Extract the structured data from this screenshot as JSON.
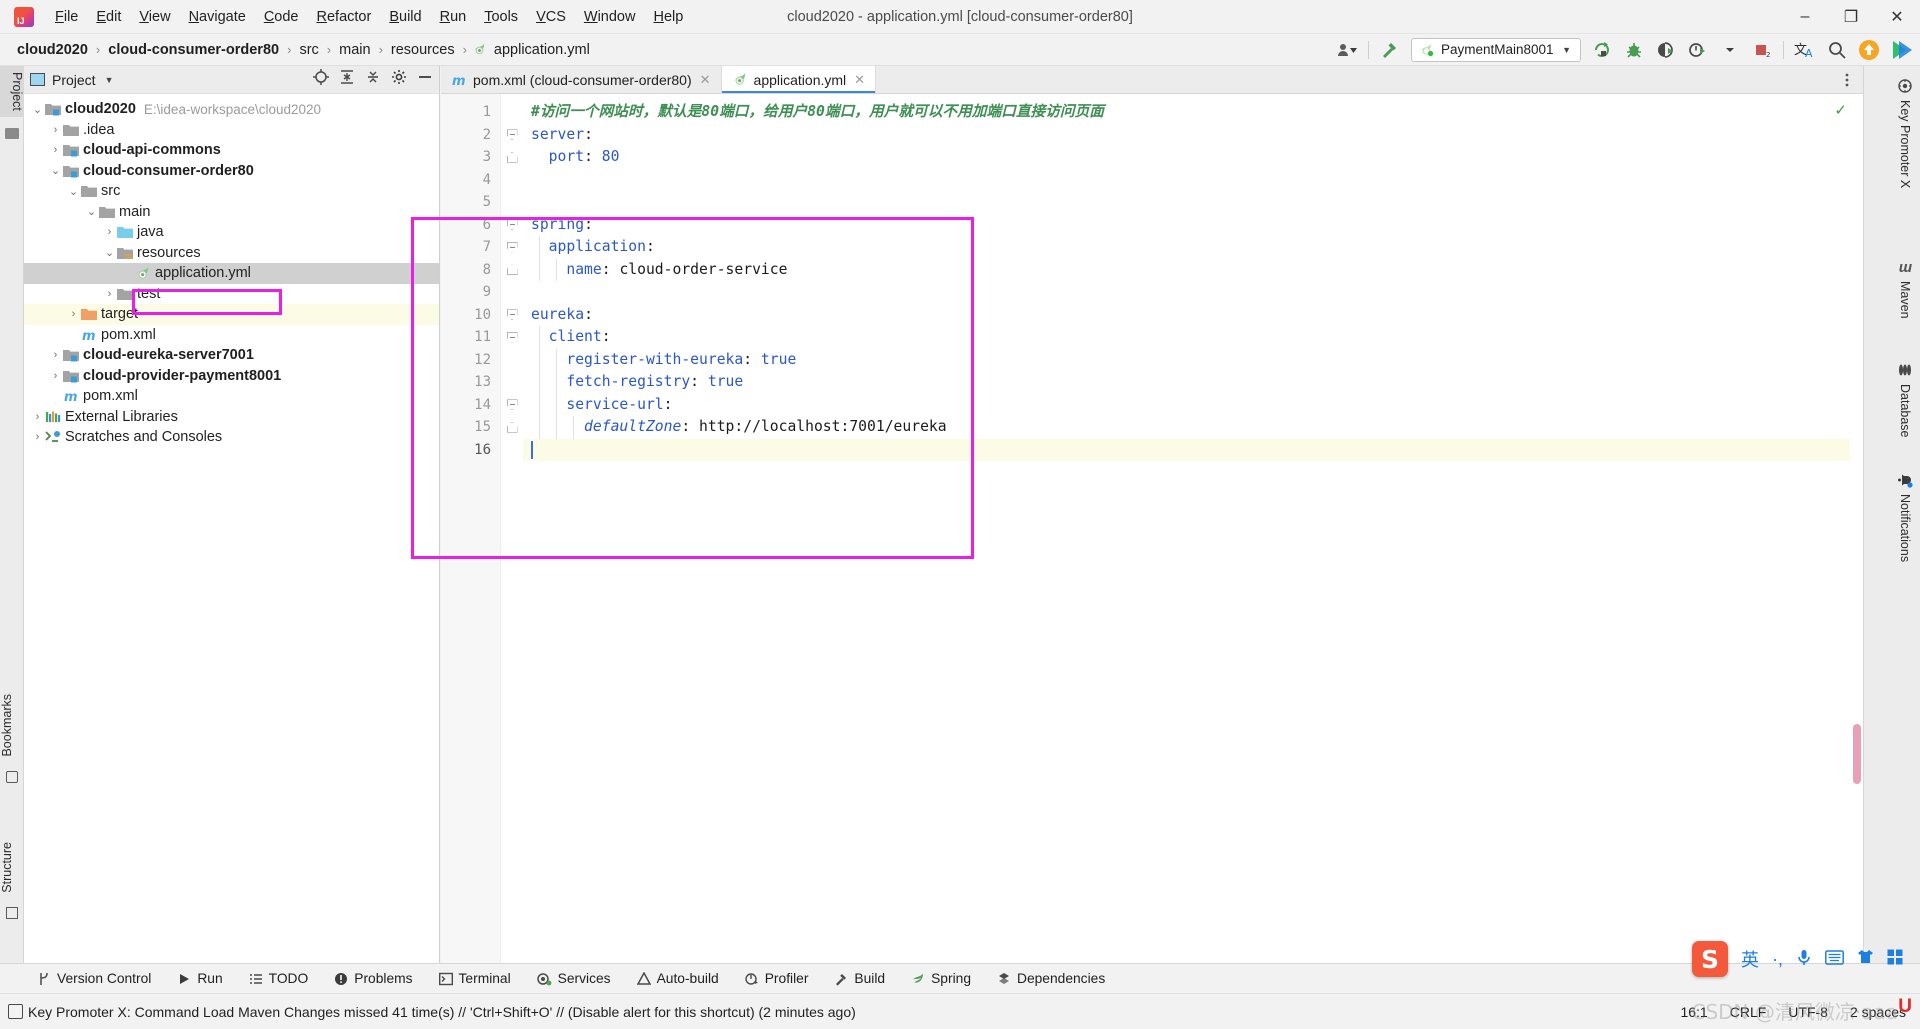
{
  "window": {
    "title": "cloud2020 - application.yml [cloud-consumer-order80]",
    "minimize": "–",
    "maximize": "❐",
    "close": "✕"
  },
  "menubar": {
    "items": [
      {
        "label": "File"
      },
      {
        "label": "Edit"
      },
      {
        "label": "View"
      },
      {
        "label": "Navigate"
      },
      {
        "label": "Code"
      },
      {
        "label": "Refactor"
      },
      {
        "label": "Build"
      },
      {
        "label": "Run"
      },
      {
        "label": "Tools"
      },
      {
        "label": "VCS"
      },
      {
        "label": "Window"
      },
      {
        "label": "Help"
      }
    ]
  },
  "breadcrumb": {
    "separator": "›",
    "items": [
      {
        "label": "cloud2020",
        "bold": true
      },
      {
        "label": "cloud-consumer-order80",
        "bold": true
      },
      {
        "label": "src",
        "bold": false
      },
      {
        "label": "main",
        "bold": false
      },
      {
        "label": "resources",
        "bold": false
      },
      {
        "label": "application.yml",
        "bold": false,
        "icon": "yml-file-icon"
      }
    ]
  },
  "toolbar": {
    "run_config_label": "PaymentMain8001",
    "icons": [
      {
        "name": "user-dropdown-icon"
      },
      {
        "name": "build-hammer-icon"
      },
      {
        "name": "rerun-icon"
      },
      {
        "name": "debug-bug-icon"
      },
      {
        "name": "coverage-icon"
      },
      {
        "name": "profiler-icon"
      },
      {
        "name": "stop-icon"
      },
      {
        "name": "translate-icon"
      },
      {
        "name": "search-everywhere-icon"
      },
      {
        "name": "update-badge-icon"
      },
      {
        "name": "ide-feature-icon"
      }
    ]
  },
  "left_strip": {
    "tabs": [
      {
        "label": "Project",
        "active": true
      },
      {
        "label": "Bookmarks",
        "active": false
      },
      {
        "label": "Structure",
        "active": false
      }
    ]
  },
  "project_panel": {
    "title": "Project",
    "header_icons": [
      "locate-icon",
      "expand-all-icon",
      "collapse-all-icon",
      "gear-icon",
      "hide-icon"
    ],
    "tree": [
      {
        "depth": 0,
        "arrow": "⌄",
        "icon": "module-folder-icon",
        "label": "cloud2020",
        "bold": true,
        "path": "E:\\idea-workspace\\cloud2020",
        "state": "normal"
      },
      {
        "depth": 1,
        "arrow": "›",
        "icon": "folder-icon",
        "label": ".idea",
        "bold": false,
        "path": "",
        "state": "normal"
      },
      {
        "depth": 1,
        "arrow": "›",
        "icon": "module-folder-icon",
        "label": "cloud-api-commons",
        "bold": true,
        "path": "",
        "state": "normal"
      },
      {
        "depth": 1,
        "arrow": "⌄",
        "icon": "module-folder-icon",
        "label": "cloud-consumer-order80",
        "bold": true,
        "path": "",
        "state": "normal"
      },
      {
        "depth": 2,
        "arrow": "⌄",
        "icon": "folder-icon",
        "label": "src",
        "bold": false,
        "path": "",
        "state": "normal"
      },
      {
        "depth": 3,
        "arrow": "⌄",
        "icon": "folder-icon",
        "label": "main",
        "bold": false,
        "path": "",
        "state": "normal"
      },
      {
        "depth": 4,
        "arrow": "›",
        "icon": "source-folder-icon",
        "label": "java",
        "bold": false,
        "path": "",
        "state": "normal"
      },
      {
        "depth": 4,
        "arrow": "⌄",
        "icon": "resource-folder-icon",
        "label": "resources",
        "bold": false,
        "path": "",
        "state": "normal"
      },
      {
        "depth": 5,
        "arrow": "",
        "icon": "yml-file-icon",
        "label": "application.yml",
        "bold": false,
        "path": "",
        "state": "selected"
      },
      {
        "depth": 4,
        "arrow": "›",
        "icon": "folder-icon",
        "label": "test",
        "bold": false,
        "path": "",
        "state": "normal"
      },
      {
        "depth": 2,
        "arrow": "›",
        "icon": "target-folder-icon",
        "label": "target",
        "bold": false,
        "path": "",
        "state": "highlight"
      },
      {
        "depth": 2,
        "arrow": "",
        "icon": "maven-file-icon",
        "label": "pom.xml",
        "bold": false,
        "path": "",
        "state": "normal"
      },
      {
        "depth": 1,
        "arrow": "›",
        "icon": "module-folder-icon",
        "label": "cloud-eureka-server7001",
        "bold": true,
        "path": "",
        "state": "normal"
      },
      {
        "depth": 1,
        "arrow": "›",
        "icon": "module-folder-icon",
        "label": "cloud-provider-payment8001",
        "bold": true,
        "path": "",
        "state": "normal"
      },
      {
        "depth": 1,
        "arrow": "",
        "icon": "maven-file-icon",
        "label": "pom.xml",
        "bold": false,
        "path": "",
        "state": "normal"
      },
      {
        "depth": 0,
        "arrow": "›",
        "icon": "libraries-icon",
        "label": "External Libraries",
        "bold": false,
        "path": "",
        "state": "normal"
      },
      {
        "depth": 0,
        "arrow": "›",
        "icon": "scratches-icon",
        "label": "Scratches and Consoles",
        "bold": false,
        "path": "",
        "state": "normal"
      }
    ]
  },
  "editor": {
    "tabs": [
      {
        "label": "pom.xml (cloud-consumer-order80)",
        "icon": "maven-file-icon",
        "active": false,
        "close": "✕"
      },
      {
        "label": "application.yml",
        "icon": "yml-file-icon",
        "active": true,
        "close": "✕"
      }
    ],
    "inspection_mark": "✓",
    "line_numbers": [
      "1",
      "2",
      "3",
      "4",
      "5",
      "6",
      "7",
      "8",
      "9",
      "10",
      "11",
      "12",
      "13",
      "14",
      "15",
      "16"
    ],
    "lines": [
      {
        "n": 1,
        "fold": "",
        "segments": [
          {
            "t": "#访问一个网站时，默认是80端口，给用户80端口，用户就可以不用加端口直接访问页面",
            "c": "cm"
          }
        ]
      },
      {
        "n": 2,
        "fold": "open",
        "segments": [
          {
            "t": "server",
            "c": "k"
          },
          {
            "t": ":",
            "c": "v"
          }
        ]
      },
      {
        "n": 3,
        "fold": "end",
        "segments": [
          {
            "t": "  port",
            "c": "k"
          },
          {
            "t": ": ",
            "c": "v"
          },
          {
            "t": "80",
            "c": "n"
          }
        ]
      },
      {
        "n": 4,
        "fold": "",
        "segments": []
      },
      {
        "n": 5,
        "fold": "",
        "segments": []
      },
      {
        "n": 6,
        "fold": "open",
        "segments": [
          {
            "t": "spring",
            "c": "k"
          },
          {
            "t": ":",
            "c": "v"
          }
        ]
      },
      {
        "n": 7,
        "fold": "open",
        "segments": [
          {
            "t": "  application",
            "c": "k"
          },
          {
            "t": ":",
            "c": "v"
          }
        ]
      },
      {
        "n": 8,
        "fold": "end",
        "segments": [
          {
            "t": "    name",
            "c": "k"
          },
          {
            "t": ": ",
            "c": "v"
          },
          {
            "t": "cloud-order-service",
            "c": "v"
          }
        ]
      },
      {
        "n": 9,
        "fold": "",
        "segments": []
      },
      {
        "n": 10,
        "fold": "open",
        "segments": [
          {
            "t": "eureka",
            "c": "k"
          },
          {
            "t": ":",
            "c": "v"
          }
        ]
      },
      {
        "n": 11,
        "fold": "open",
        "segments": [
          {
            "t": "  client",
            "c": "k"
          },
          {
            "t": ":",
            "c": "v"
          }
        ]
      },
      {
        "n": 12,
        "fold": "",
        "segments": [
          {
            "t": "    register-with-eureka",
            "c": "k"
          },
          {
            "t": ": ",
            "c": "v"
          },
          {
            "t": "true",
            "c": "n"
          }
        ]
      },
      {
        "n": 13,
        "fold": "",
        "segments": [
          {
            "t": "    fetch-registry",
            "c": "k"
          },
          {
            "t": ": ",
            "c": "v"
          },
          {
            "t": "true",
            "c": "n"
          }
        ]
      },
      {
        "n": 14,
        "fold": "open",
        "segments": [
          {
            "t": "    service-url",
            "c": "k"
          },
          {
            "t": ":",
            "c": "v"
          }
        ]
      },
      {
        "n": 15,
        "fold": "end",
        "segments": [
          {
            "t": "      defaultZone",
            "c": "it"
          },
          {
            "t": ": ",
            "c": "v"
          },
          {
            "t": "http://localhost:7001/eureka",
            "c": "v"
          }
        ]
      },
      {
        "n": 16,
        "fold": "",
        "segments": [],
        "current": true
      }
    ]
  },
  "right_strip": {
    "tabs": [
      {
        "label": "Key Promoter X",
        "icon": "key-promoter-icon"
      },
      {
        "label": "Maven",
        "icon": "maven-icon"
      },
      {
        "label": "Database",
        "icon": "database-icon"
      },
      {
        "label": "Notifications",
        "icon": "notifications-icon"
      }
    ]
  },
  "bottom_tools": {
    "items": [
      {
        "label": "Version Control",
        "icon": "branch-icon"
      },
      {
        "label": "Run",
        "icon": "play-icon"
      },
      {
        "label": "TODO",
        "icon": "todo-icon"
      },
      {
        "label": "Problems",
        "icon": "problems-icon"
      },
      {
        "label": "Terminal",
        "icon": "terminal-icon"
      },
      {
        "label": "Services",
        "icon": "services-icon"
      },
      {
        "label": "Auto-build",
        "icon": "autobuild-icon"
      },
      {
        "label": "Profiler",
        "icon": "profiler-icon"
      },
      {
        "label": "Build",
        "icon": "build-hammer-icon"
      },
      {
        "label": "Spring",
        "icon": "spring-leaf-icon"
      },
      {
        "label": "Dependencies",
        "icon": "dependencies-icon"
      }
    ]
  },
  "statusbar": {
    "message": "Key Promoter X: Command Load Maven Changes missed 41 time(s) // 'Ctrl+Shift+O' // (Disable alert for this shortcut) (2 minutes ago)",
    "caret": "16:1",
    "line_separator": "CRLF",
    "encoding": "UTF-8",
    "indent": "2 spaces"
  },
  "ime": {
    "language": "英",
    "icons": [
      "sogou-logo",
      "punctuation-icon",
      "microphone-icon",
      "keyboard-icon",
      "skin-icon",
      "toolbox-icon"
    ]
  },
  "watermark": {
    "text": "CSDN @清风微凉·aaa",
    "badge": "U"
  },
  "colors": {
    "magenta_highlight": "#e81fe8",
    "accent_blue": "#3d87dd",
    "comment_green": "#3f8f54",
    "key_blue": "#2b57c9",
    "highlight_row": "#fbfbe6",
    "selection_gray": "#d0d0d0"
  }
}
